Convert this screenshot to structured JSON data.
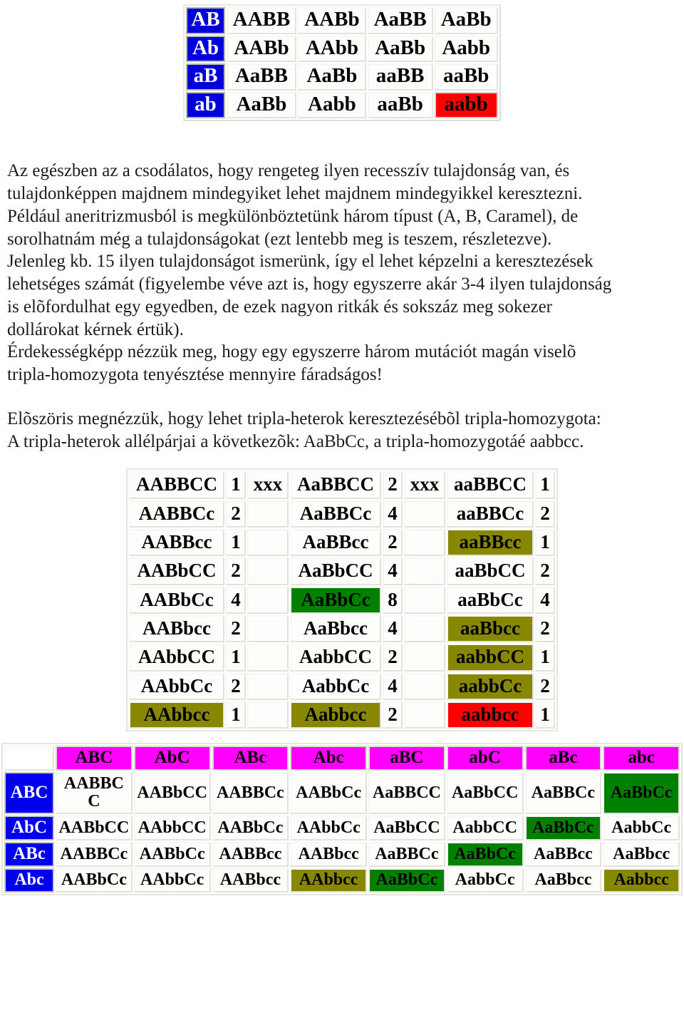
{
  "punnett": {
    "name": "dihybrid-punnett-square",
    "row_headers": [
      "AB",
      "Ab",
      "aB",
      "ab"
    ],
    "rows": [
      [
        "AABB",
        "AABb",
        "AaBB",
        "AaBb"
      ],
      [
        "AABb",
        "AAbb",
        "AaBb",
        "Aabb"
      ],
      [
        "AaBB",
        "AaBb",
        "aaBB",
        "aaBb"
      ],
      [
        "AaBb",
        "Aabb",
        "aaBb",
        "aabb"
      ]
    ],
    "highlight_red": "aabb",
    "header_bg": "#0000dd",
    "red_bg": "#ff0000"
  },
  "prose": {
    "paragraph1": [
      "Az egészben az a csodálatos, hogy rengeteg ilyen recesszív tulajdonság van, és",
      "tulajdonképpen majdnem mindegyiket lehet majdnem mindegyikkel keresztezni.",
      "Például aneritrizmusból is megkülönböztetünk három típust (A, B, Caramel), de",
      "sorolhatnám még a tulajdonságokat (ezt lentebb meg is teszem, részletezve).",
      "Jelenleg kb. 15 ilyen tulajdonságot ismerünk, így el lehet képzelni a keresztezések",
      "lehetséges számát (figyelembe véve azt is, hogy egyszerre akár 3-4 ilyen tulajdonság",
      "is elõfordulhat egy egyedben, de ezek nagyon ritkák és sokszáz meg sokezer",
      "dollárokat kérnek értük).",
      "Érdekességképp nézzük meg, hogy egy egyszerre három mutációt magán viselõ",
      "tripla-homozygota tenyésztése mennyire fáradságos!"
    ],
    "paragraph2": [
      "Elõszöris megnézzük, hogy lehet tripla-heterok keresztezésébõl tripla-homozygota:",
      "A tripla-heterok allélpárjai a következõk: AaBbCc, a tripla-homozygotáé aabbcc."
    ]
  },
  "ratio_table": {
    "name": "trihybrid-ratio-table",
    "spacer_top_label": "xxx",
    "rows": [
      {
        "c1": "AABBCC",
        "n1": "1",
        "s1": "xxx",
        "c2": "AaBBCC",
        "n2": "2",
        "s2": "xxx",
        "c3": "aaBBCC",
        "n3": "1",
        "h1": "",
        "h2": "",
        "h3": ""
      },
      {
        "c1": "AABBCc",
        "n1": "2",
        "s1": "",
        "c2": "AaBBCc",
        "n2": "4",
        "s2": "",
        "c3": "aaBBCc",
        "n3": "2",
        "h1": "",
        "h2": "",
        "h3": ""
      },
      {
        "c1": "AABBcc",
        "n1": "1",
        "s1": "",
        "c2": "AaBBcc",
        "n2": "2",
        "s2": "",
        "c3": "aaBBcc",
        "n3": "1",
        "h1": "",
        "h2": "",
        "h3": "olive"
      },
      {
        "c1": "AABbCC",
        "n1": "2",
        "s1": "",
        "c2": "AaBbCC",
        "n2": "4",
        "s2": "",
        "c3": "aaBbCC",
        "n3": "2",
        "h1": "",
        "h2": "",
        "h3": ""
      },
      {
        "c1": "AABbCc",
        "n1": "4",
        "s1": "",
        "c2": "AaBbCc",
        "n2": "8",
        "s2": "",
        "c3": "aaBbCc",
        "n3": "4",
        "h1": "",
        "h2": "green",
        "h3": ""
      },
      {
        "c1": "AABbcc",
        "n1": "2",
        "s1": "",
        "c2": "AaBbcc",
        "n2": "4",
        "s2": "",
        "c3": "aaBbcc",
        "n3": "2",
        "h1": "",
        "h2": "",
        "h3": "olive"
      },
      {
        "c1": "AAbbCC",
        "n1": "1",
        "s1": "",
        "c2": "AabbCC",
        "n2": "2",
        "s2": "",
        "c3": "aabbCC",
        "n3": "1",
        "h1": "",
        "h2": "",
        "h3": "olive"
      },
      {
        "c1": "AAbbCc",
        "n1": "2",
        "s1": "",
        "c2": "AabbCc",
        "n2": "4",
        "s2": "",
        "c3": "aabbCc",
        "n3": "2",
        "h1": "",
        "h2": "",
        "h3": "olive"
      },
      {
        "c1": "AAbbcc",
        "n1": "1",
        "s1": "",
        "c2": "Aabbcc",
        "n2": "2",
        "s2": "",
        "c3": "aabbcc",
        "n3": "1",
        "h1": "olive",
        "h2": "olive",
        "h3": "red"
      }
    ],
    "colors": {
      "olive": "#888800",
      "green": "#008000",
      "red": "#ff0000"
    }
  },
  "big_table": {
    "name": "trihybrid-punnett-square",
    "corner": "",
    "col_headers": [
      "ABC",
      "AbC",
      "ABc",
      "Abc",
      "aBC",
      "abC",
      "aBc",
      "abc"
    ],
    "row_headers": [
      "ABC",
      "AbC",
      "ABc",
      "Abc"
    ],
    "rows": [
      [
        "AABBCC",
        "AABbCC",
        "AABBCc",
        "AABbCc",
        "AaBBCC",
        "AaBbCC",
        "AaBBCc",
        "AaBbCc"
      ],
      [
        "AABbCC",
        "AAbbCC",
        "AABbCc",
        "AAbbCc",
        "AaBbCC",
        "AabbCC",
        "AaBbCc",
        "AabbCc"
      ],
      [
        "AABBCc",
        "AABbCc",
        "AABBcc",
        "AABbcc",
        "AaBBCc",
        "AaBbCc",
        "AaBBcc",
        "AaBbcc"
      ],
      [
        "AABbCc",
        "AAbbCc",
        "AABbcc",
        "AAbbcc",
        "AaBbCc",
        "AabbCc",
        "AaBbcc",
        "Aabbcc"
      ]
    ],
    "highlights": [
      [
        "",
        "",
        "",
        "",
        "",
        "",
        "",
        "green"
      ],
      [
        "",
        "",
        "",
        "",
        "",
        "",
        "green",
        ""
      ],
      [
        "",
        "",
        "",
        "",
        "",
        "green",
        "",
        ""
      ],
      [
        "",
        "",
        "",
        "olive",
        "green",
        "",
        "",
        "olive"
      ]
    ],
    "colors": {
      "header_col": "#ff00ff",
      "header_row": "#0000ee",
      "green": "#008000",
      "olive": "#888800"
    }
  }
}
